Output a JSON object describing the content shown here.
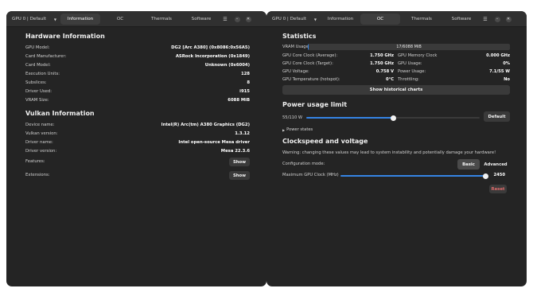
{
  "left": {
    "gpu_selector": "GPU 0 | Default",
    "tabs": [
      "Information",
      "OC",
      "Thermals",
      "Software"
    ],
    "active_tab": 0,
    "hardware": {
      "title": "Hardware Information",
      "rows": [
        {
          "label": "GPU Model:",
          "value": "DG2 [Arc A380] (0x8086:0x56A5)"
        },
        {
          "label": "Card Manufacturer:",
          "value": "ASRock Incorporation (0x1849)"
        },
        {
          "label": "Card Model:",
          "value": "Unknown (0x6004)"
        },
        {
          "label": "Execution Units:",
          "value": "128"
        },
        {
          "label": "Subslices:",
          "value": "8"
        },
        {
          "label": "Driver Used:",
          "value": "i915"
        },
        {
          "label": "VRAM Size:",
          "value": "6088 MiB"
        }
      ]
    },
    "vulkan": {
      "title": "Vulkan Information",
      "rows": [
        {
          "label": "Device name:",
          "value": "Intel(R) Arc(tm) A380 Graphics (DG2)"
        },
        {
          "label": "Vulkan version:",
          "value": "1.3.12"
        },
        {
          "label": "Driver name:",
          "value": "Intel open-source Mesa driver"
        },
        {
          "label": "Driver version:",
          "value": "Mesa 22.3.6"
        },
        {
          "label": "Features:",
          "button": "Show"
        },
        {
          "label": "Extensions:",
          "button": "Show"
        }
      ]
    }
  },
  "right": {
    "gpu_selector": "GPU 0 | Default",
    "tabs": [
      "Information",
      "OC",
      "Thermals",
      "Software"
    ],
    "active_tab": 1,
    "stats": {
      "title": "Statistics",
      "vram_label": "VRAM Usage",
      "vram_text": "17/6088 MiB",
      "vram_fraction": 0.003,
      "left_col": [
        {
          "label": "GPU Core Clock (Average):",
          "value": "1.750 GHz"
        },
        {
          "label": "GPU Core Clock (Target):",
          "value": "1.750 GHz"
        },
        {
          "label": "GPU Voltage:",
          "value": "0.758 V"
        },
        {
          "label": "GPU Temperature (hotspot):",
          "value": "0°C"
        }
      ],
      "right_col": [
        {
          "label": "GPU Memory Clock",
          "value": "0.000 GHz"
        },
        {
          "label": "GPU Usage:",
          "value": "0%"
        },
        {
          "label": "Power Usage:",
          "value": "7.1/55 W"
        },
        {
          "label": "Throttling:",
          "value": "No"
        }
      ],
      "charts_button": "Show historical charts"
    },
    "power": {
      "title": "Power usage limit",
      "value_text": "55/110 W",
      "fraction": 0.5,
      "default_button": "Default",
      "states_label": "Power states"
    },
    "clock": {
      "title": "Clockspeed and voltage",
      "warning": "Warning: changing these values may lead to system instability and potentially damage your hardware!",
      "config_label": "Configuration mode:",
      "modes": [
        "Basic",
        "Advanced"
      ],
      "active_mode": 0,
      "max_clock_label": "Maximum GPU Clock (MHz)",
      "max_clock_value": "2450",
      "max_clock_fraction": 1.0,
      "reset_button": "Reset"
    }
  },
  "colors": {
    "accent": "#3584e4",
    "reset": "#e06c6c",
    "window_bg": "#242424",
    "header_bg": "#303030"
  },
  "icons": [
    "hamburger-menu-icon",
    "minimize-icon",
    "close-icon",
    "chevron-right-icon"
  ]
}
